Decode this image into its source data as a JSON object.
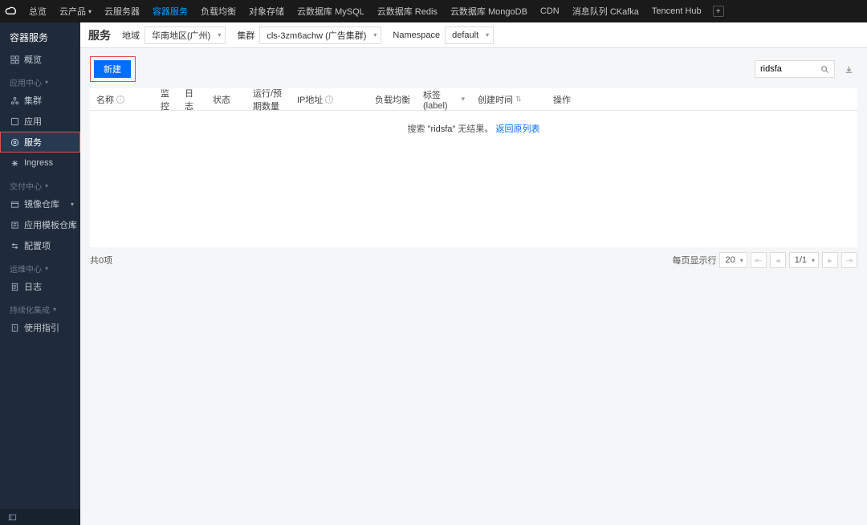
{
  "topnav": {
    "items": [
      {
        "label": "总览"
      },
      {
        "label": "云产品",
        "caret": true
      },
      {
        "label": "云服务器"
      },
      {
        "label": "容器服务",
        "active": true
      },
      {
        "label": "负载均衡"
      },
      {
        "label": "对象存储"
      },
      {
        "label": "云数据库 MySQL"
      },
      {
        "label": "云数据库 Redis"
      },
      {
        "label": "云数据库 MongoDB"
      },
      {
        "label": "CDN"
      },
      {
        "label": "消息队列 CKafka"
      },
      {
        "label": "Tencent Hub"
      }
    ]
  },
  "sidebar": {
    "product_title": "容器服务",
    "items": [
      {
        "label": "概览",
        "icon": "overview-icon"
      }
    ],
    "sec_app": {
      "title": "应用中心",
      "items": [
        {
          "label": "集群",
          "icon": "cluster-icon"
        },
        {
          "label": "应用",
          "icon": "app-icon"
        },
        {
          "label": "服务",
          "icon": "service-icon",
          "active": true,
          "outlined": true
        },
        {
          "label": "Ingress",
          "icon": "ingress-icon"
        }
      ]
    },
    "sec_deliver": {
      "title": "交付中心",
      "items": [
        {
          "label": "镜像仓库",
          "icon": "image-repo-icon",
          "expandable": true
        },
        {
          "label": "应用模板仓库",
          "icon": "template-repo-icon",
          "expandable": true
        },
        {
          "label": "配置项",
          "icon": "config-icon"
        }
      ]
    },
    "sec_ops": {
      "title": "运维中心",
      "items": [
        {
          "label": "日志",
          "icon": "log-icon"
        }
      ]
    },
    "sec_cicd": {
      "title": "持续化集成",
      "items": [
        {
          "label": "使用指引",
          "icon": "guide-icon"
        }
      ]
    }
  },
  "header": {
    "page_title": "服务",
    "region_label": "地域",
    "region_value": "华南地区(广州)",
    "cluster_label": "集群",
    "cluster_value": "cls-3zm6achw (广告集群)",
    "namespace_label": "Namespace",
    "namespace_value": "default"
  },
  "toolbar": {
    "new_label": "新建",
    "search_value": "ridsfa"
  },
  "table": {
    "cols": {
      "name": "名称",
      "monitor": "监控",
      "log": "日志",
      "status": "状态",
      "pods": "运行/预期数量",
      "ip": "IP地址",
      "lb": "负载均衡",
      "label": "标签(label)",
      "ctime": "创建时间",
      "op": "操作"
    }
  },
  "empty": {
    "prefix": "搜索 ",
    "keyword": "\"ridsfa\"",
    "mid": " 无结果。",
    "link": "返回原列表"
  },
  "pager": {
    "total": "共0项",
    "per_page_label": "每页显示行",
    "per_page_value": "20",
    "page_display": "1/1"
  }
}
